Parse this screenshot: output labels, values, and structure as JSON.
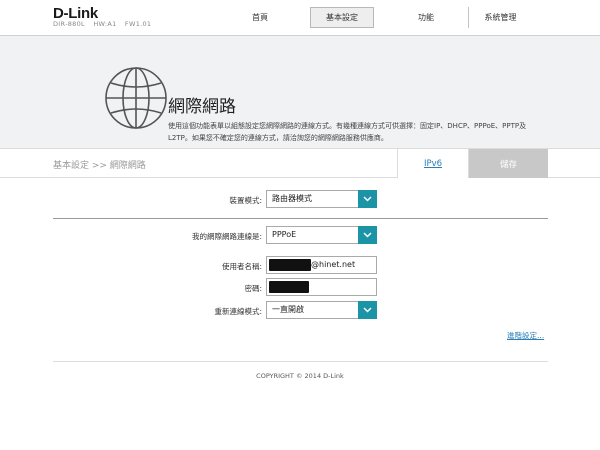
{
  "brand": {
    "logo": "D-Link",
    "model": "DIR-880L",
    "hw": "HW:A1",
    "fw": "FW1.01"
  },
  "nav": [
    {
      "label": "首頁",
      "active": false
    },
    {
      "label": "基本設定",
      "active": true
    },
    {
      "label": "功能",
      "active": false
    },
    {
      "label": "系統管理",
      "active": false
    }
  ],
  "banner": {
    "title": "網際網路",
    "description": "使用這個功能表單以組態設定您網際網路的連線方式。有幾種連線方式可供選擇：固定IP、DHCP、PPPoE、PPTP及L2TP。如果您不確定您的連線方式，請洽詢您的網際網路服務供應商。",
    "icon": "globe-icon"
  },
  "breadcrumb": "基本設定 >> 網際網路",
  "buttons": {
    "ipv6": "IPv6",
    "save": "儲存"
  },
  "form": {
    "device_mode": {
      "label": "裝置模式:",
      "value": "路由器模式"
    },
    "connection_type": {
      "label": "我的網際網路連線是:",
      "value": "PPPoE"
    },
    "username": {
      "label": "使用者名稱:",
      "value": "@hinet.net"
    },
    "password": {
      "label": "密碼:",
      "value": ""
    },
    "reconnect_mode": {
      "label": "重新連線模式:",
      "value": "一直開啟"
    }
  },
  "advanced_link": "進階設定...",
  "footer": {
    "copyright": "COPYRIGHT © 2014 D-Link"
  },
  "colors": {
    "accent": "#1b94a5",
    "link": "#2a7fb8",
    "save_button": "#c8c8c8",
    "banner_bg": "#f1f2f3"
  }
}
